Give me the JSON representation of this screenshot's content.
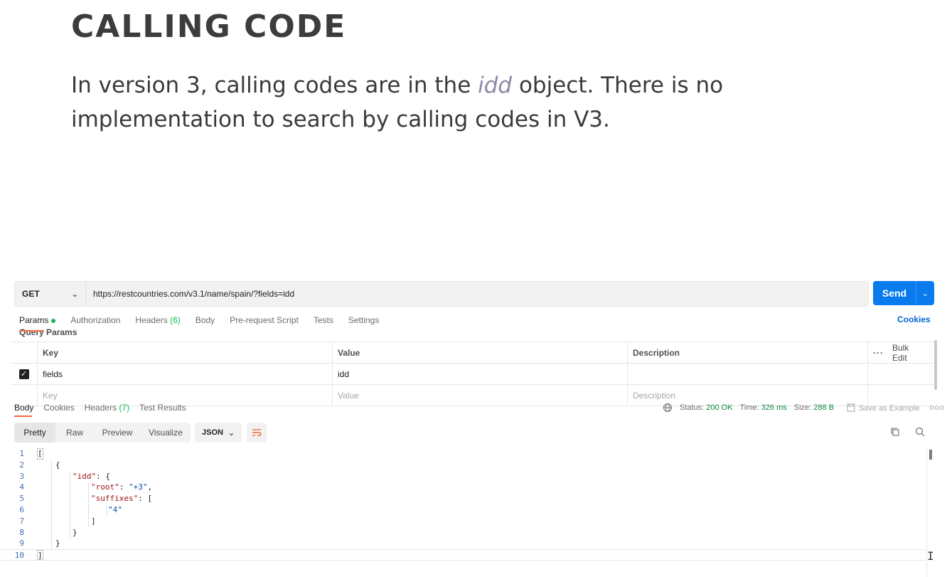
{
  "article": {
    "heading": "CALLING CODE",
    "para_before": "In version 3, calling codes are in the ",
    "para_em": "idd",
    "para_after": " object. There is no implementation to search by calling codes in V3."
  },
  "request": {
    "method": "GET",
    "url": "https://restcountries.com/v3.1/name/spain/?fields=idd",
    "send_label": "Send"
  },
  "request_tabs": {
    "params": "Params",
    "authorization": "Authorization",
    "headers": "Headers",
    "headers_count": "(6)",
    "body": "Body",
    "pre_request": "Pre-request Script",
    "tests": "Tests",
    "settings": "Settings",
    "cookies": "Cookies"
  },
  "params": {
    "section_label": "Query Params",
    "headers": {
      "key": "Key",
      "value": "Value",
      "description": "Description",
      "bulk_edit": "Bulk Edit"
    },
    "rows": [
      {
        "key": "fields",
        "value": "idd",
        "description": "",
        "checked": true
      }
    ],
    "placeholders": {
      "key": "Key",
      "value": "Value",
      "description": "Description"
    }
  },
  "response_tabs": {
    "body": "Body",
    "cookies": "Cookies",
    "headers": "Headers",
    "headers_count": "(7)",
    "test_results": "Test Results"
  },
  "response_status": {
    "status_label": "Status:",
    "status_value": "200 OK",
    "time_label": "Time:",
    "time_value": "326 ms",
    "size_label": "Size:",
    "size_value": "288 B",
    "save_example": "Save as Example"
  },
  "viewer": {
    "modes": [
      "Pretty",
      "Raw",
      "Preview",
      "Visualize"
    ],
    "format": "JSON"
  },
  "code_lines": {
    "l1": {
      "num": "1",
      "text": "["
    },
    "l2": {
      "num": "2",
      "text": "{"
    },
    "l3": {
      "num": "3",
      "key": "\"idd\"",
      "rest": ": {"
    },
    "l4": {
      "num": "4",
      "key": "\"root\"",
      "sep": ": ",
      "str": "\"+3\"",
      "rest": ","
    },
    "l5": {
      "num": "5",
      "key": "\"suffixes\"",
      "rest": ": ["
    },
    "l6": {
      "num": "6",
      "str": "\"4\""
    },
    "l7": {
      "num": "7",
      "text": "]"
    },
    "l8": {
      "num": "8",
      "text": "}"
    },
    "l9": {
      "num": "9",
      "text": "}"
    },
    "l10": {
      "num": "10",
      "text": "]"
    }
  }
}
